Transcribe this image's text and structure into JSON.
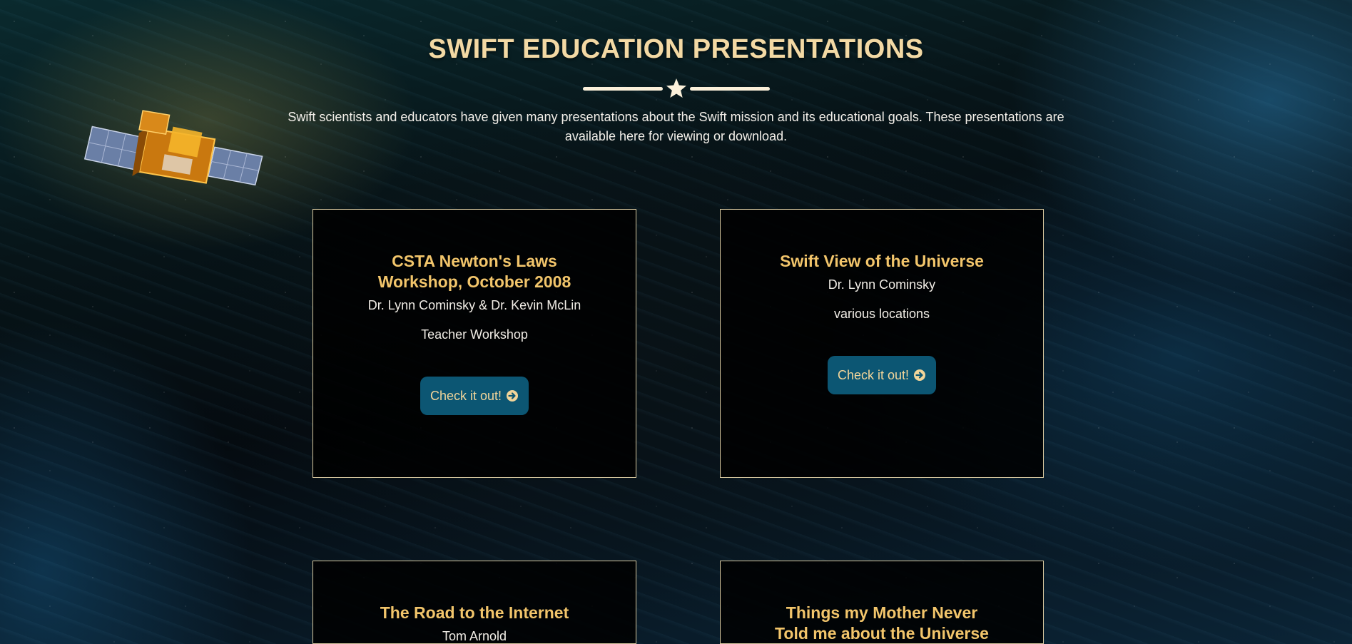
{
  "page": {
    "title": "SWIFT EDUCATION PRESENTATIONS",
    "intro": "Swift scientists and educators have given many presentations about the Swift mission and its educational goals. These presentations are available here for viewing or download."
  },
  "cards": [
    {
      "title": "CSTA Newton's Laws Workshop, October 2008",
      "author": "Dr. Lynn Cominsky & Dr. Kevin McLin",
      "location": "Teacher Workshop",
      "button_label": "Check it out!"
    },
    {
      "title": "Swift View of the Universe",
      "author": "Dr. Lynn Cominsky",
      "location": "various locations",
      "button_label": "Check it out!"
    },
    {
      "title": "The Road to the Internet",
      "author": "Tom Arnold"
    },
    {
      "title": "Things my Mother Never Told me about the Universe"
    }
  ],
  "icons": {
    "divider": "star-icon",
    "button": "arrow-circle-right-icon",
    "hero": "swift-satellite-icon"
  },
  "colors": {
    "title": "#f3d9a4",
    "card_title": "#f2c56b",
    "button_bg": "#0c5673",
    "button_text": "#f2d59a",
    "card_border": "#d8c9a0"
  }
}
